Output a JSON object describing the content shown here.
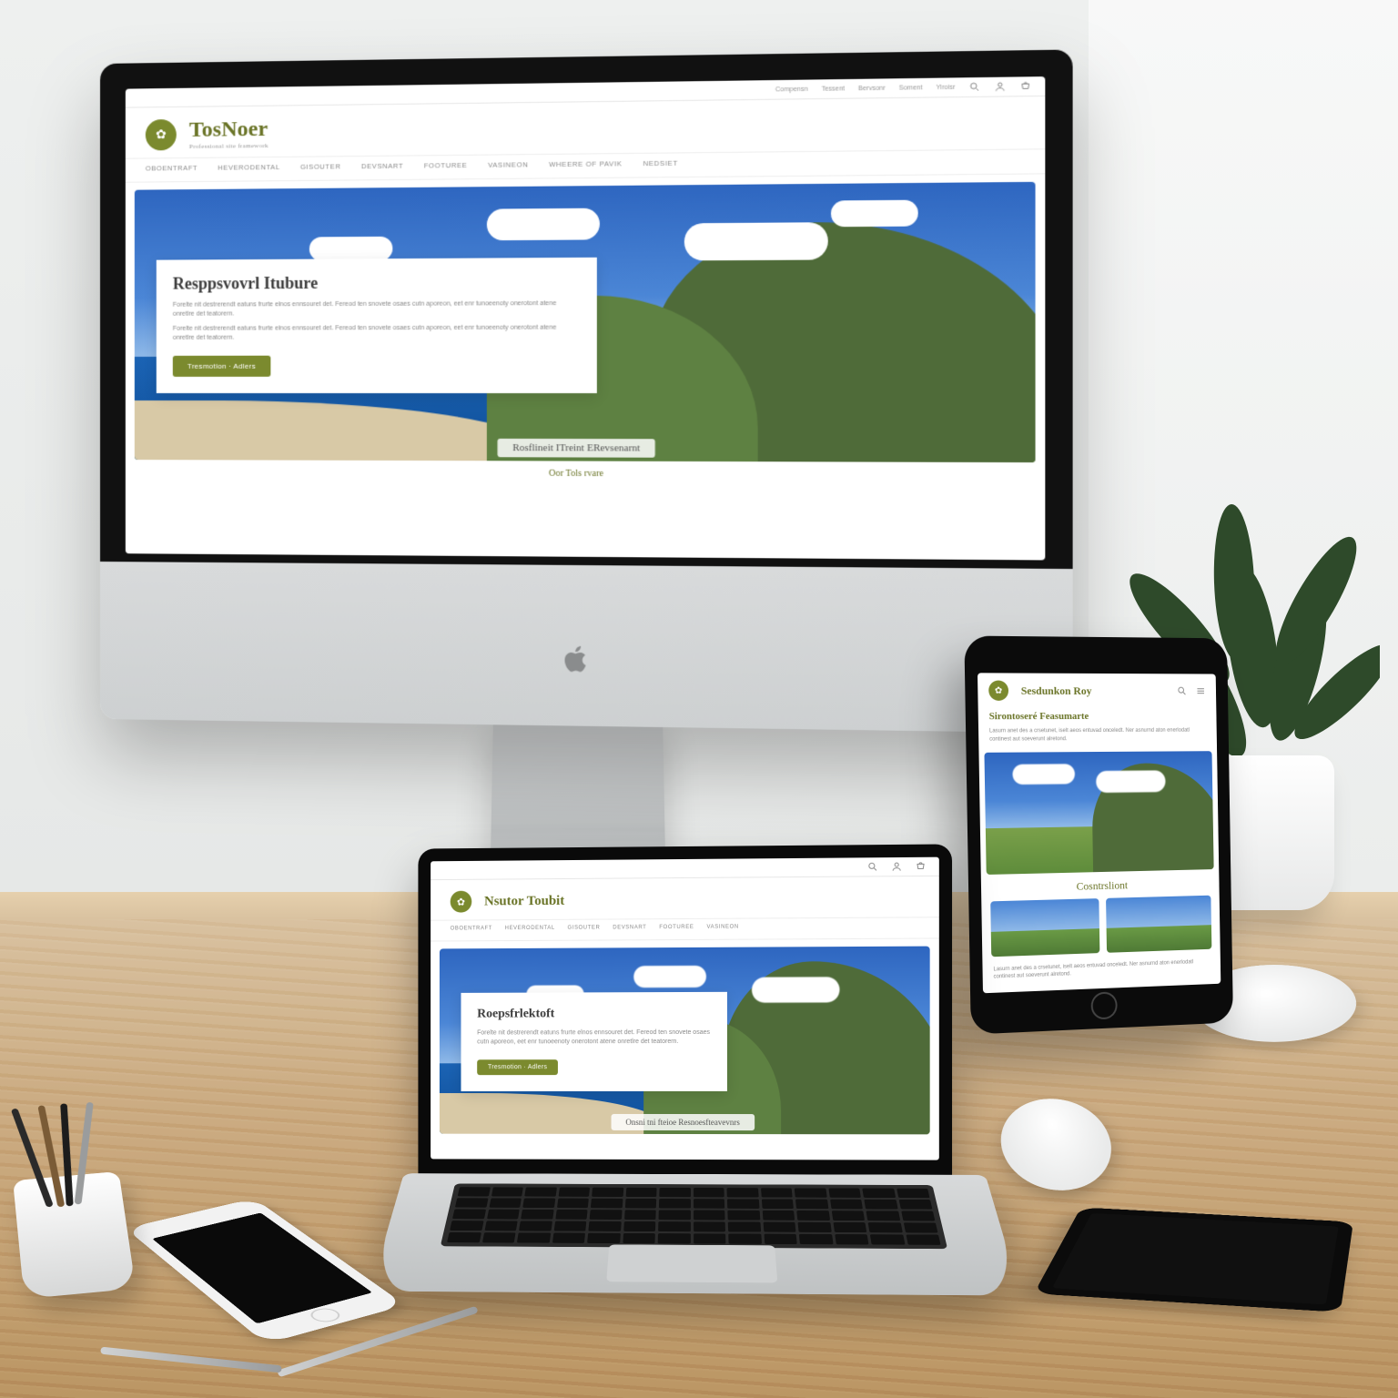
{
  "colors": {
    "accent": "#7b8a2e"
  },
  "topbar": {
    "items": [
      "Compensn",
      "Tessent",
      "Bervsonr",
      "Soment",
      "Yiroisr"
    ]
  },
  "brand": {
    "name": "TosNoer",
    "tagline": "Professional site framework"
  },
  "nav": {
    "items": [
      "Oboentraft",
      "Heverodental",
      "Gisouter",
      "Devsnart",
      "Footuree",
      "Vasineon",
      "Wheere of Pavik",
      "Nedsiet"
    ]
  },
  "hero": {
    "title": "Resppsvovrl Itubure",
    "body": "Forelte nit destrerendt eatuns frurte elnos ennsouret det. Fereod ten snovete osaes cutn aporeon, eet enr tunoeenoty onerotont atene onretlre det teatorern.",
    "cta": "Tresmotion · Adlers",
    "tagline": "Rosflineit ITreint ERevsenarnt"
  },
  "subnote": "Oor Tols rvare",
  "laptop": {
    "brand": "Nsutor Toubit",
    "hero_title": "Roepsfrlektoft",
    "tagline": "Onsni tni fteioe Resnoesfteavevnrs"
  },
  "tablet": {
    "brand": "Sesdunkon Roy",
    "intro_title": "Sirontoseré Feasumarte",
    "section_title": "Cosntrsliont",
    "intro_body": "Lasurn anet des a crsetunet, iselt aeos entuvad onceledt. Ner asnurnd aton enerlodatl continest aut soeverunt alretond."
  }
}
